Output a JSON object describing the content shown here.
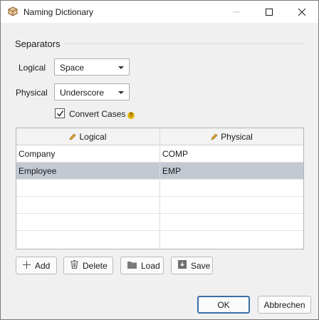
{
  "window": {
    "title": "Naming Dictionary",
    "icons": {
      "app": "box-icon",
      "minimize": "minimize-icon",
      "maximize": "maximize-icon",
      "close": "close-icon"
    }
  },
  "separators": {
    "group_label": "Separators",
    "logical_label": "Logical",
    "logical_value": "Space",
    "physical_label": "Physical",
    "physical_value": "Underscore"
  },
  "convert_cases": {
    "label": "Convert Cases",
    "checked": true,
    "help_glyph": "?"
  },
  "grid": {
    "columns": [
      "Logical",
      "Physical"
    ],
    "rows": [
      {
        "logical": "Company",
        "physical": "COMP",
        "selected": false
      },
      {
        "logical": "Employee",
        "physical": "EMP",
        "selected": true
      }
    ]
  },
  "toolbar": {
    "add": "Add",
    "delete": "Delete",
    "load": "Load",
    "save": "Save"
  },
  "dialog": {
    "ok": "OK",
    "cancel": "Abbrechen"
  },
  "colors": {
    "selection": "#c3c9d3",
    "accent_border": "#3a6ea5",
    "help": "#e3b30f"
  }
}
